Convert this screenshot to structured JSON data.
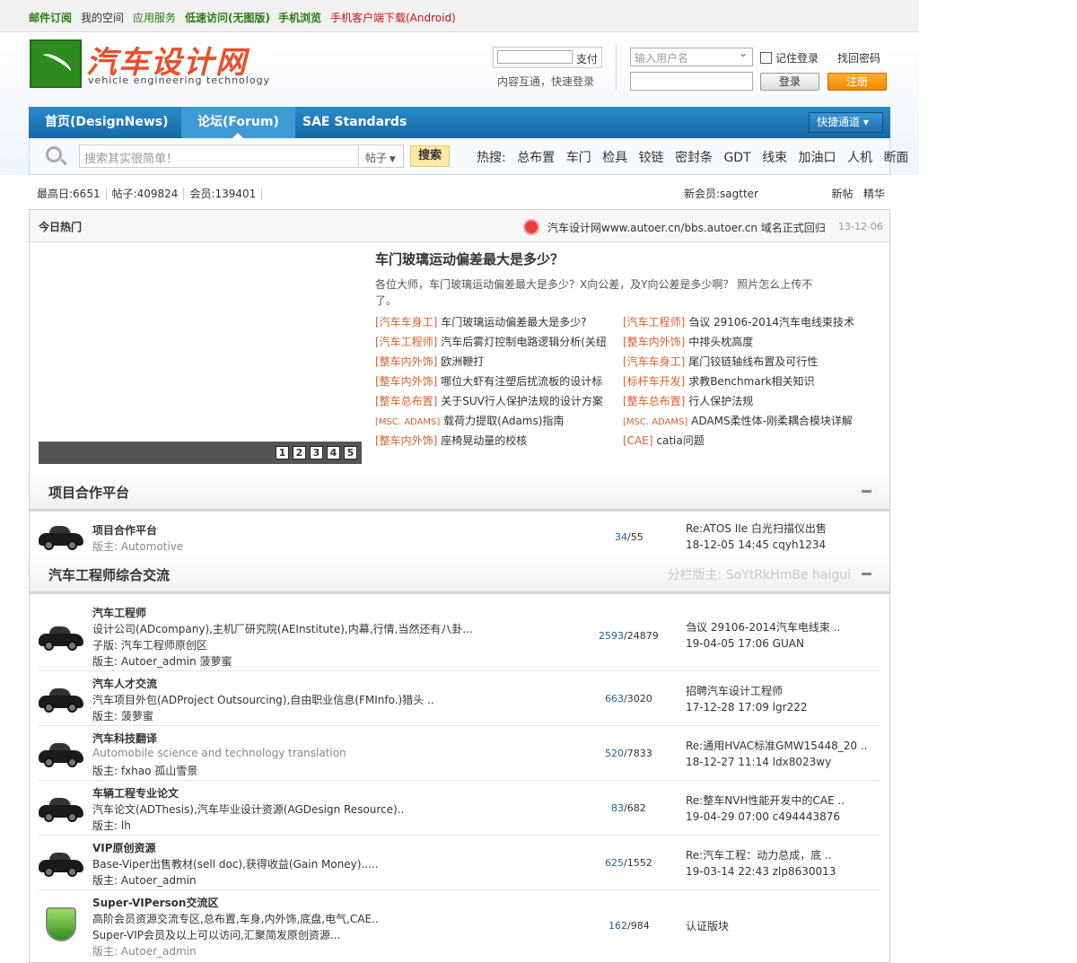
{
  "topbar": {
    "mail": "邮件订阅",
    "space": "我的空间",
    "apps": "应用服务",
    "lite": "低速访问(无图版)",
    "mobile": "手机浏览",
    "android": "手机客户端下载(Android)"
  },
  "logo": {
    "cn": "汽车设计网",
    "en": "vehicle engineering technology"
  },
  "search_small": {
    "label": "支付",
    "sub": "内容互通，快速登录"
  },
  "login": {
    "user_placeholder": "输入用户名",
    "remember": "记住登录",
    "forgot": "找回密码",
    "login_btn": "登录",
    "register_btn": "注册"
  },
  "nav": {
    "home": "首页(DesignNews)",
    "forum": "论坛(Forum)",
    "sae": "SAE Standards",
    "quick": "快捷通道"
  },
  "search": {
    "placeholder": "搜索其实很简单！",
    "type": "帖子",
    "btn": "搜索",
    "hot_label": "热搜:",
    "hot": [
      "总布置",
      "车门",
      "检具",
      "铰链",
      "密封条",
      "GDT",
      "线束",
      "加油口",
      "人机",
      "断面"
    ]
  },
  "stats": {
    "today": "最高日:6651",
    "posts": "帖子:409824",
    "members": "会员:139401",
    "newest": "新会员:sagtter",
    "new": "新帖",
    "digest": "精华"
  },
  "today": {
    "title": "今日热门",
    "notice": "汽车设计网www.autoer.cn/bbs.autoer.cn 域名正式回归",
    "date": "13-12-06",
    "slides": [
      "1",
      "2",
      "3",
      "4",
      "5"
    ],
    "headline": "车门玻璃运动偏差最大是多少？",
    "desc": "各位大师，车门玻璃运动偏差最大是多少？X向公差，及Y向公差是多少啊？ 照片怎么上传不了。",
    "left": [
      [
        "[汽车车身工]",
        "车门玻璃运动偏差最大是多少?"
      ],
      [
        "[汽车工程师]",
        "汽车后雾灯控制电路逻辑分析(关纽"
      ],
      [
        "[整车内外饰]",
        "欧洲鞭打"
      ],
      [
        "[整车内外饰]",
        "哪位大虾有注塑后扰流板的设计标"
      ],
      [
        "[整车总布置]",
        "关于SUV行人保护法规的设计方案"
      ],
      [
        "[MSC. ADAMS]",
        "载荷力提取(Adams)指南"
      ],
      [
        "[整车内外饰]",
        "座椅晃动量的校核"
      ]
    ],
    "right": [
      [
        "[汽车工程师]",
        "刍议 29106-2014汽车电线束技术"
      ],
      [
        "[整车内外饰]",
        "中排头枕高度"
      ],
      [
        "[汽车车身工]",
        "尾门铰链轴线布置及可行性"
      ],
      [
        "[标杆车开发]",
        "求教Benchmark相关知识"
      ],
      [
        "[整车总布置]",
        "行人保护法规"
      ],
      [
        "[MSC. ADAMS]",
        "ADAMS柔性体-刚柔耦合模块详解"
      ],
      [
        "[CAE]",
        "catia问题"
      ]
    ]
  },
  "sec1": {
    "title": "项目合作平台",
    "forum": {
      "name": "项目合作平台",
      "mod": "版主: Automotive",
      "topics": "34",
      "posts": "/55",
      "last1": "Re:ATOS IIe 白光扫描仪出售",
      "last2": "18-12-05 14:45  cqyh1234"
    }
  },
  "sec2": {
    "title": "汽车工程师综合交流",
    "mods": "分栏版主:  SoYtRkHmBe haigui",
    "forums": [
      {
        "name": "汽车工程师",
        "l1": "设计公司(ADcompany),主机厂研究院(AEInstitute),内幕,行情,当然还有八卦...",
        "l2": "子版: 汽车工程师原创区",
        "l3": "版主: Autoer_admin 菠萝蜜",
        "topics": "2593",
        "posts": "/24879",
        "last1": "刍议 29106-2014汽车电线束 ..",
        "last2": "19-04-05 17:06  GUAN"
      },
      {
        "name": "汽车人才交流",
        "l1": "汽车项目外包(ADProject Outsourcing),自由职业信息(FMInfo.)猎头 ..",
        "l2": "版主: 菠萝蜜",
        "topics": "663",
        "posts": "/3020",
        "last1": "招聘汽车设计工程师",
        "last2": "17-12-28 17:09  lgr222"
      },
      {
        "name": "汽车科技翻译",
        "l1": "Automobile science and technology translation",
        "l2": "版主: fxhao 孤山雪景",
        "topics": "520",
        "posts": "/7833",
        "last1": "Re:通用HVAC标准GMW15448_20 ..",
        "last2": "18-12-27 11:14  ldx8023wy"
      },
      {
        "name": "车辆工程专业论文",
        "l1": "汽车论文(ADThesis),汽车毕业设计资源(AGDesign Resource)..",
        "l2": "版主: lh",
        "topics": "83",
        "posts": "/682",
        "last1": "Re:整车NVH性能开发中的CAE ..",
        "last2": "19-04-29 07:00  c494443876"
      },
      {
        "name": "VIP原创资源",
        "l1": "Base-Viper出售教材(sell doc),获得收益(Gain Money).....",
        "l2": "版主: Autoer_admin",
        "topics": "625",
        "posts": "/1552",
        "last1": "Re:汽车工程：动力总成，底 ..",
        "last2": "19-03-14 22:43  zlp8630013"
      },
      {
        "name": "Super-VIPerson交流区",
        "l1": "高阶会员资源交流专区,总布置,车身,内外饰,底盘,电气,CAE..",
        "l2": "Super-VIP会员及以上可以访问,汇聚简发原创资源...",
        "l3": "版主: Autoer_admin",
        "topics": "162",
        "posts": "/984",
        "last1": "认证版块",
        "last2": ""
      }
    ]
  }
}
